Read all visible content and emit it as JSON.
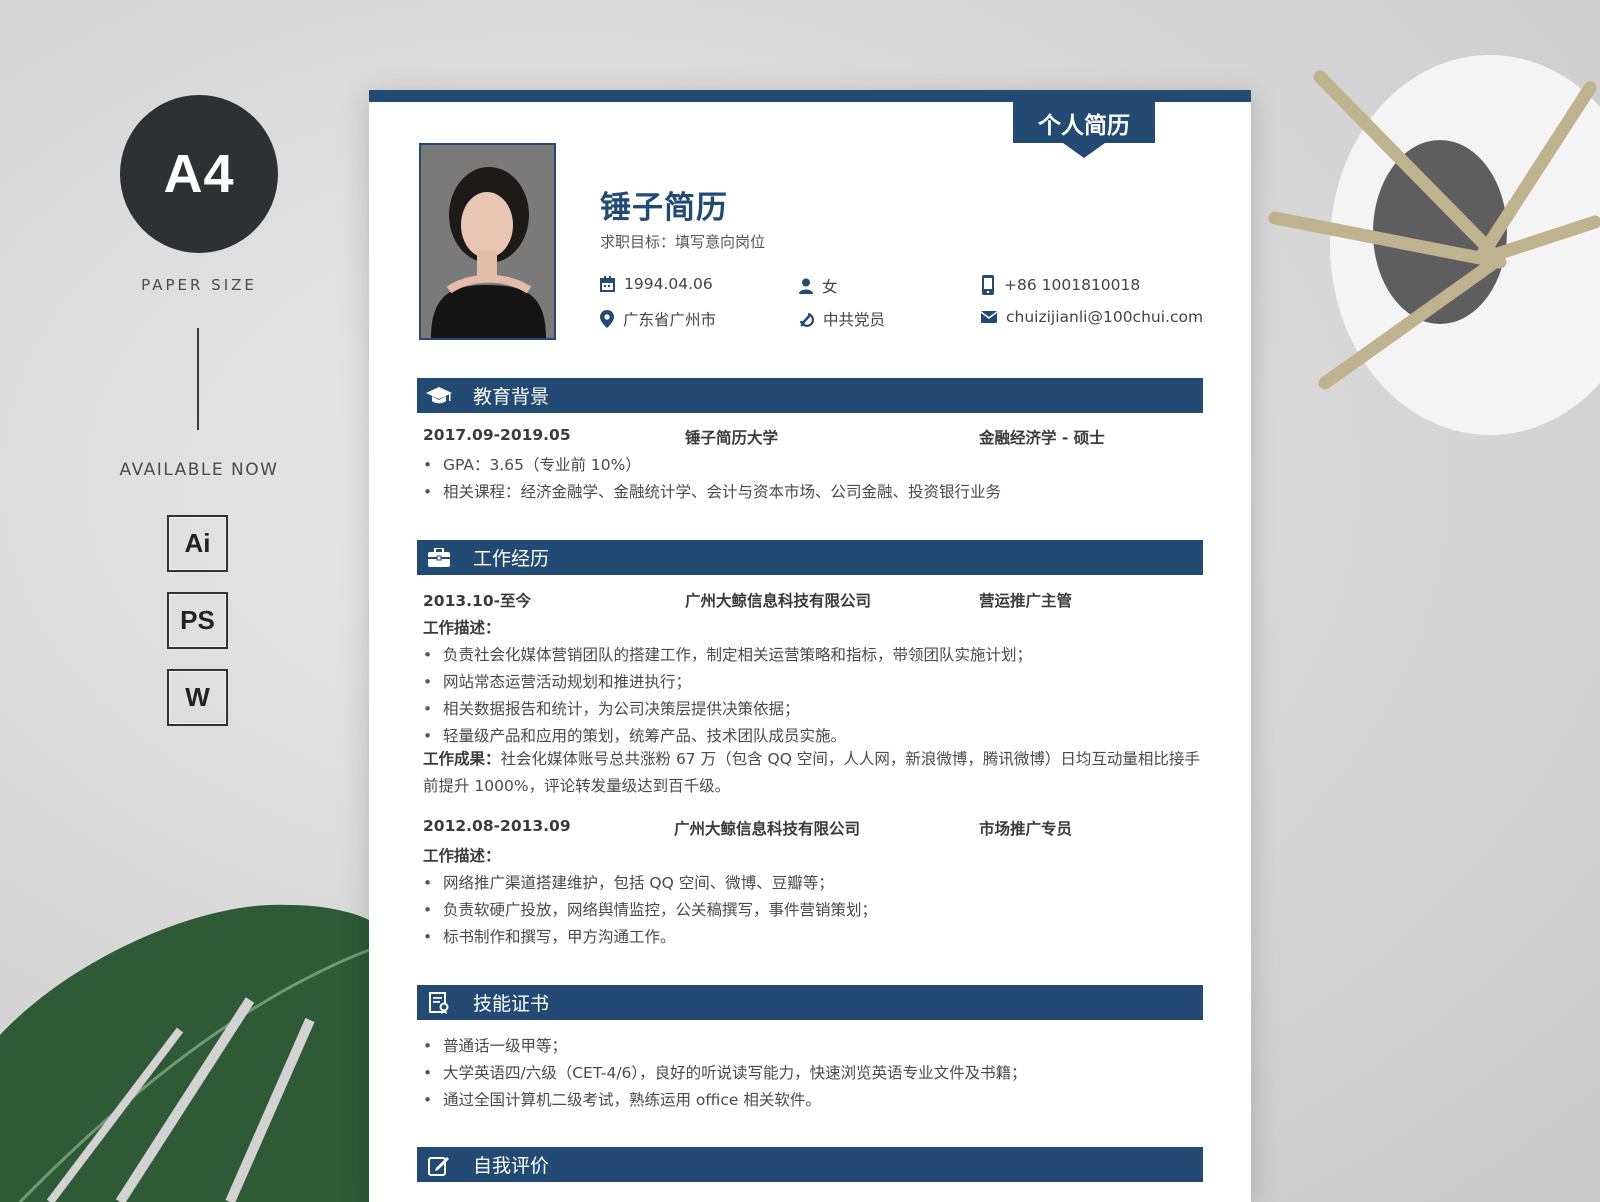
{
  "mockup": {
    "paper_badge": "A4",
    "paper_label": "PAPER SIZE",
    "available_label": "AVAILABLE NOW",
    "formats": [
      "Ai",
      "PS",
      "W"
    ]
  },
  "resume": {
    "banner": "个人简历",
    "name": "锤子简历",
    "target": "求职目标：填写意向岗位",
    "info": {
      "birth": "1994.04.06",
      "gender": "女",
      "phone": "+86 1001810018",
      "location": "广东省广州市",
      "politics": "中共党员",
      "email": "chuizijianli@100chui.com"
    },
    "education": {
      "title": "教育背景",
      "period": "2017.09-2019.05",
      "school": "锤子简历大学",
      "major": "金融经济学 - 硕士",
      "items": [
        "GPA：3.65（专业前 10%）",
        "相关课程：经济金融学、金融统计学、会计与资本市场、公司金融、投资银行业务"
      ]
    },
    "work": {
      "title": "工作经历",
      "jobs": [
        {
          "period": "2013.10-至今",
          "company": "广州大鲸信息科技有限公司",
          "position": "营运推广主管",
          "desc_label": "工作描述：",
          "items": [
            "负责社会化媒体营销团队的搭建工作，制定相关运营策略和指标，带领团队实施计划；",
            "网站常态运营活动规划和推进执行；",
            "相关数据报告和统计，为公司决策层提供决策依据；",
            "轻量级产品和应用的策划，统筹产品、技术团队成员实施。"
          ],
          "result_label": "工作成果：",
          "result": "社会化媒体账号总共涨粉 67 万（包含 QQ 空间，人人网，新浪微博，腾讯微博）日均互动量相比接手前提升 1000%，评论转发量级达到百千级。"
        },
        {
          "period": "2012.08-2013.09",
          "company": "广州大鲸信息科技有限公司",
          "position": "市场推广专员",
          "desc_label": "工作描述：",
          "items": [
            "网络推广渠道搭建维护，包括 QQ 空间、微博、豆瓣等；",
            "负责软硬广投放，网络舆情监控，公关稿撰写，事件营销策划；",
            "标书制作和撰写，甲方沟通工作。"
          ]
        }
      ]
    },
    "skills": {
      "title": "技能证书",
      "items": [
        "普通话一级甲等；",
        "大学英语四/六级（CET-4/6），良好的听说读写能力，快速浏览英语专业文件及书籍；",
        "通过全国计算机二级考试，熟练运用 office 相关软件。"
      ]
    },
    "self": {
      "title": "自我评价"
    }
  },
  "colors": {
    "primary": "#234a73",
    "text": "#4a4a4a"
  }
}
